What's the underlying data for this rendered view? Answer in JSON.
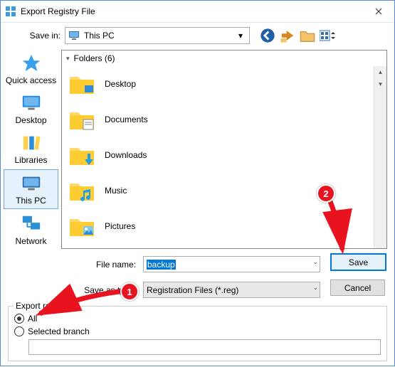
{
  "window": {
    "title": "Export Registry File"
  },
  "toolbar": {
    "save_in_label": "Save in:",
    "location": "This PC",
    "icons": [
      "back-icon",
      "up-icon",
      "new-folder-icon",
      "view-menu-icon"
    ]
  },
  "places": [
    {
      "id": "quick-access",
      "label": "Quick access"
    },
    {
      "id": "desktop",
      "label": "Desktop"
    },
    {
      "id": "libraries",
      "label": "Libraries"
    },
    {
      "id": "this-pc",
      "label": "This PC",
      "selected": true
    },
    {
      "id": "network",
      "label": "Network"
    }
  ],
  "list": {
    "group_label": "Folders (6)",
    "items": [
      {
        "name": "Desktop"
      },
      {
        "name": "Documents"
      },
      {
        "name": "Downloads"
      },
      {
        "name": "Music"
      },
      {
        "name": "Pictures"
      }
    ]
  },
  "fields": {
    "file_name_label": "File name:",
    "file_name_value": "backup",
    "save_type_label": "Save as type:",
    "save_type_value": "Registration Files (*.reg)"
  },
  "buttons": {
    "save": "Save",
    "cancel": "Cancel"
  },
  "export_range": {
    "title": "Export range",
    "all": "All",
    "selected_branch": "Selected branch",
    "choice": "all",
    "branch_value": ""
  },
  "annotations": {
    "badge1": "1",
    "badge2": "2"
  }
}
